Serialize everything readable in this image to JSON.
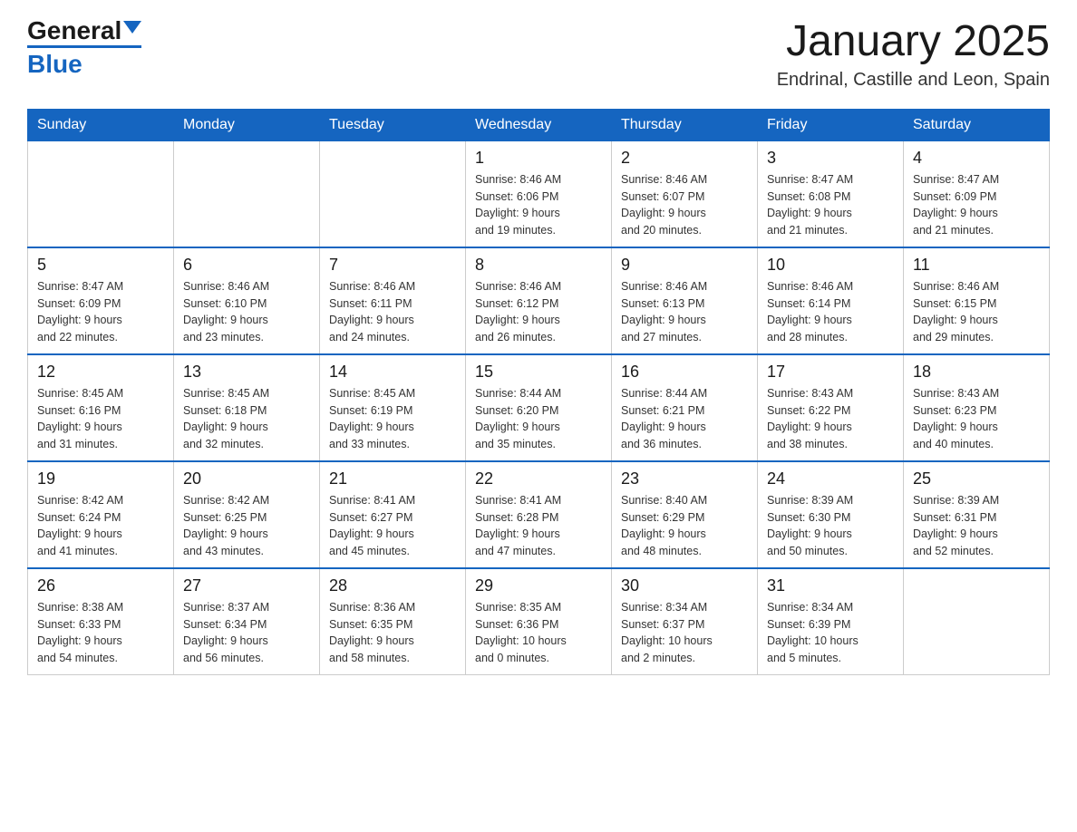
{
  "header": {
    "logo_text_main": "General",
    "logo_text_blue": "Blue",
    "title": "January 2025",
    "subtitle": "Endrinal, Castille and Leon, Spain"
  },
  "calendar": {
    "days_of_week": [
      "Sunday",
      "Monday",
      "Tuesday",
      "Wednesday",
      "Thursday",
      "Friday",
      "Saturday"
    ],
    "weeks": [
      [
        {
          "day": "",
          "info": ""
        },
        {
          "day": "",
          "info": ""
        },
        {
          "day": "",
          "info": ""
        },
        {
          "day": "1",
          "info": "Sunrise: 8:46 AM\nSunset: 6:06 PM\nDaylight: 9 hours\nand 19 minutes."
        },
        {
          "day": "2",
          "info": "Sunrise: 8:46 AM\nSunset: 6:07 PM\nDaylight: 9 hours\nand 20 minutes."
        },
        {
          "day": "3",
          "info": "Sunrise: 8:47 AM\nSunset: 6:08 PM\nDaylight: 9 hours\nand 21 minutes."
        },
        {
          "day": "4",
          "info": "Sunrise: 8:47 AM\nSunset: 6:09 PM\nDaylight: 9 hours\nand 21 minutes."
        }
      ],
      [
        {
          "day": "5",
          "info": "Sunrise: 8:47 AM\nSunset: 6:09 PM\nDaylight: 9 hours\nand 22 minutes."
        },
        {
          "day": "6",
          "info": "Sunrise: 8:46 AM\nSunset: 6:10 PM\nDaylight: 9 hours\nand 23 minutes."
        },
        {
          "day": "7",
          "info": "Sunrise: 8:46 AM\nSunset: 6:11 PM\nDaylight: 9 hours\nand 24 minutes."
        },
        {
          "day": "8",
          "info": "Sunrise: 8:46 AM\nSunset: 6:12 PM\nDaylight: 9 hours\nand 26 minutes."
        },
        {
          "day": "9",
          "info": "Sunrise: 8:46 AM\nSunset: 6:13 PM\nDaylight: 9 hours\nand 27 minutes."
        },
        {
          "day": "10",
          "info": "Sunrise: 8:46 AM\nSunset: 6:14 PM\nDaylight: 9 hours\nand 28 minutes."
        },
        {
          "day": "11",
          "info": "Sunrise: 8:46 AM\nSunset: 6:15 PM\nDaylight: 9 hours\nand 29 minutes."
        }
      ],
      [
        {
          "day": "12",
          "info": "Sunrise: 8:45 AM\nSunset: 6:16 PM\nDaylight: 9 hours\nand 31 minutes."
        },
        {
          "day": "13",
          "info": "Sunrise: 8:45 AM\nSunset: 6:18 PM\nDaylight: 9 hours\nand 32 minutes."
        },
        {
          "day": "14",
          "info": "Sunrise: 8:45 AM\nSunset: 6:19 PM\nDaylight: 9 hours\nand 33 minutes."
        },
        {
          "day": "15",
          "info": "Sunrise: 8:44 AM\nSunset: 6:20 PM\nDaylight: 9 hours\nand 35 minutes."
        },
        {
          "day": "16",
          "info": "Sunrise: 8:44 AM\nSunset: 6:21 PM\nDaylight: 9 hours\nand 36 minutes."
        },
        {
          "day": "17",
          "info": "Sunrise: 8:43 AM\nSunset: 6:22 PM\nDaylight: 9 hours\nand 38 minutes."
        },
        {
          "day": "18",
          "info": "Sunrise: 8:43 AM\nSunset: 6:23 PM\nDaylight: 9 hours\nand 40 minutes."
        }
      ],
      [
        {
          "day": "19",
          "info": "Sunrise: 8:42 AM\nSunset: 6:24 PM\nDaylight: 9 hours\nand 41 minutes."
        },
        {
          "day": "20",
          "info": "Sunrise: 8:42 AM\nSunset: 6:25 PM\nDaylight: 9 hours\nand 43 minutes."
        },
        {
          "day": "21",
          "info": "Sunrise: 8:41 AM\nSunset: 6:27 PM\nDaylight: 9 hours\nand 45 minutes."
        },
        {
          "day": "22",
          "info": "Sunrise: 8:41 AM\nSunset: 6:28 PM\nDaylight: 9 hours\nand 47 minutes."
        },
        {
          "day": "23",
          "info": "Sunrise: 8:40 AM\nSunset: 6:29 PM\nDaylight: 9 hours\nand 48 minutes."
        },
        {
          "day": "24",
          "info": "Sunrise: 8:39 AM\nSunset: 6:30 PM\nDaylight: 9 hours\nand 50 minutes."
        },
        {
          "day": "25",
          "info": "Sunrise: 8:39 AM\nSunset: 6:31 PM\nDaylight: 9 hours\nand 52 minutes."
        }
      ],
      [
        {
          "day": "26",
          "info": "Sunrise: 8:38 AM\nSunset: 6:33 PM\nDaylight: 9 hours\nand 54 minutes."
        },
        {
          "day": "27",
          "info": "Sunrise: 8:37 AM\nSunset: 6:34 PM\nDaylight: 9 hours\nand 56 minutes."
        },
        {
          "day": "28",
          "info": "Sunrise: 8:36 AM\nSunset: 6:35 PM\nDaylight: 9 hours\nand 58 minutes."
        },
        {
          "day": "29",
          "info": "Sunrise: 8:35 AM\nSunset: 6:36 PM\nDaylight: 10 hours\nand 0 minutes."
        },
        {
          "day": "30",
          "info": "Sunrise: 8:34 AM\nSunset: 6:37 PM\nDaylight: 10 hours\nand 2 minutes."
        },
        {
          "day": "31",
          "info": "Sunrise: 8:34 AM\nSunset: 6:39 PM\nDaylight: 10 hours\nand 5 minutes."
        },
        {
          "day": "",
          "info": ""
        }
      ]
    ]
  }
}
